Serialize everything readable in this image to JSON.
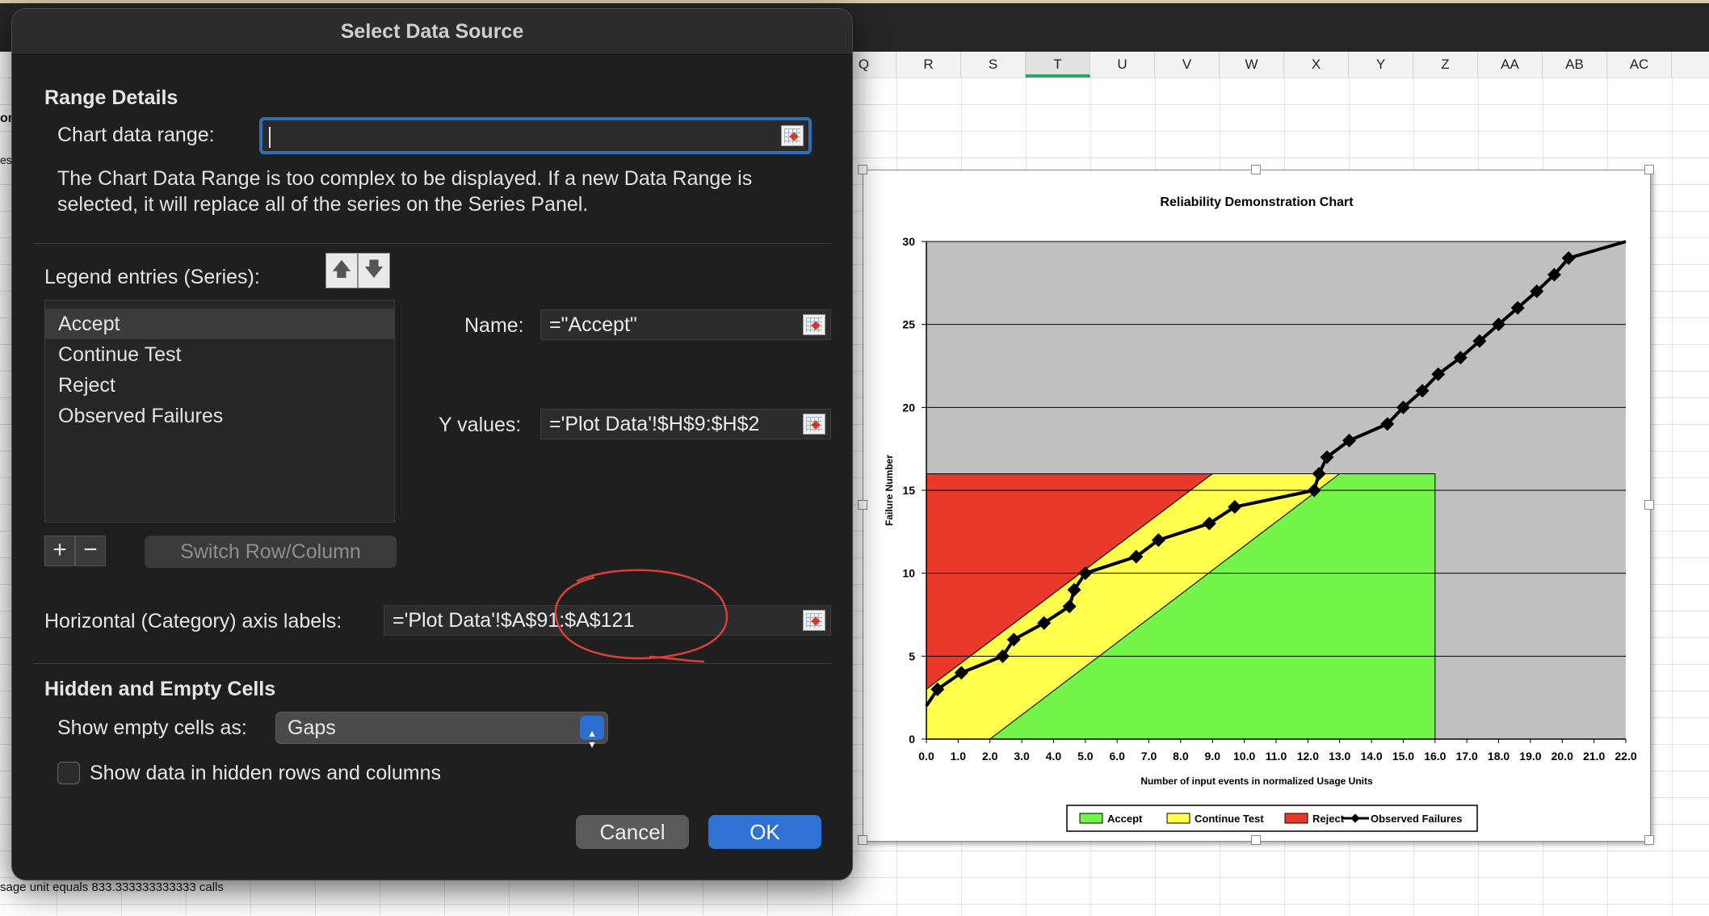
{
  "dialog": {
    "title": "Select Data Source",
    "range_details": {
      "heading": "Range Details",
      "chart_data_range_label": "Chart data range:",
      "chart_data_range_value": "",
      "note": "The Chart Data Range is too complex to be displayed. If a new Data Range is selected, it will replace all of the series on the Series Panel."
    },
    "legend": {
      "label": "Legend entries (Series):",
      "up_icon": "arrow-up-icon",
      "down_icon": "arrow-down-icon",
      "series": [
        "Accept",
        "Continue Test",
        "Reject",
        "Observed Failures"
      ],
      "selected": "Accept",
      "add_label": "+",
      "remove_label": "−",
      "switch_label": "Switch Row/Column"
    },
    "series_detail": {
      "name_label": "Name:",
      "name_value": "=\"Accept\"",
      "y_label": "Y values:",
      "y_value": "='Plot Data'!$H$9:$H$2"
    },
    "axis_labels": {
      "label": "Horizontal (Category) axis labels:",
      "value": "='Plot Data'!$A$91:$A$121"
    },
    "hidden_empty": {
      "heading": "Hidden and Empty Cells",
      "show_empty_label": "Show empty cells as:",
      "show_empty_value": "Gaps",
      "show_hidden_label": "Show data in hidden rows and columns",
      "show_hidden_checked": false
    },
    "buttons": {
      "cancel": "Cancel",
      "ok": "OK"
    },
    "accent_color": "#2f72d6",
    "annotation_color": "#d9403a"
  },
  "sheet": {
    "columns": [
      "Q",
      "R",
      "S",
      "T",
      "U",
      "V",
      "W",
      "X",
      "Y",
      "Z",
      "AA",
      "AB",
      "AC"
    ],
    "selected_column": "T",
    "left_fragment_1": "or",
    "left_fragment_2": "es",
    "bottom_note": "sage unit equals 833.333333333333 calls"
  },
  "chart_data": {
    "type": "line",
    "title": "Reliability Demonstration Chart",
    "xlabel": "Number of input events in normalized Usage Units",
    "ylabel": "Failure Number",
    "xlim": [
      0,
      22
    ],
    "ylim": [
      0,
      30
    ],
    "x_ticks": [
      "0.0",
      "1.0",
      "2.0",
      "3.0",
      "4.0",
      "5.0",
      "6.0",
      "7.0",
      "8.0",
      "9.0",
      "10.0",
      "11.0",
      "12.0",
      "13.0",
      "14.0",
      "15.0",
      "16.0",
      "17.0",
      "18.0",
      "19.0",
      "20.0",
      "21.0",
      "22.0"
    ],
    "y_ticks": [
      0,
      5,
      10,
      15,
      20,
      25,
      30
    ],
    "grid": true,
    "legend_position": "bottom",
    "regions": [
      {
        "name": "Reject",
        "color": "#e8392a",
        "polygon": [
          [
            0,
            3
          ],
          [
            9,
            16
          ],
          [
            0,
            16
          ]
        ]
      },
      {
        "name": "Continue Test",
        "color": "#ffff4d",
        "polygon": [
          [
            0,
            0
          ],
          [
            2,
            0
          ],
          [
            13,
            16
          ],
          [
            9,
            16
          ],
          [
            0,
            3
          ]
        ]
      },
      {
        "name": "Accept",
        "color": "#74f54a",
        "polygon": [
          [
            2,
            0
          ],
          [
            16,
            0
          ],
          [
            16,
            16
          ],
          [
            13,
            16
          ]
        ]
      }
    ],
    "background_color": "#c0c0c0",
    "series": [
      {
        "name": "Accept",
        "color": "#74f54a"
      },
      {
        "name": "Continue Test",
        "color": "#ffff4d"
      },
      {
        "name": "Reject",
        "color": "#e8392a"
      },
      {
        "name": "Observed Failures",
        "color": "#000000",
        "x": [
          0.0,
          0.35,
          1.1,
          2.4,
          2.75,
          3.7,
          4.5,
          4.65,
          5.0,
          6.6,
          7.3,
          8.9,
          9.7,
          12.2,
          12.35,
          12.6,
          13.3,
          14.5,
          15.0,
          15.6,
          16.1,
          16.8,
          17.4,
          18.0,
          18.6,
          19.2,
          19.75,
          20.2,
          22.0
        ],
        "y": [
          2,
          3,
          4,
          5,
          6,
          7,
          8,
          9,
          10,
          11,
          12,
          13,
          14,
          15,
          16,
          17,
          18,
          19,
          20,
          21,
          22,
          23,
          24,
          25,
          26,
          27,
          28,
          29,
          30
        ]
      }
    ]
  }
}
